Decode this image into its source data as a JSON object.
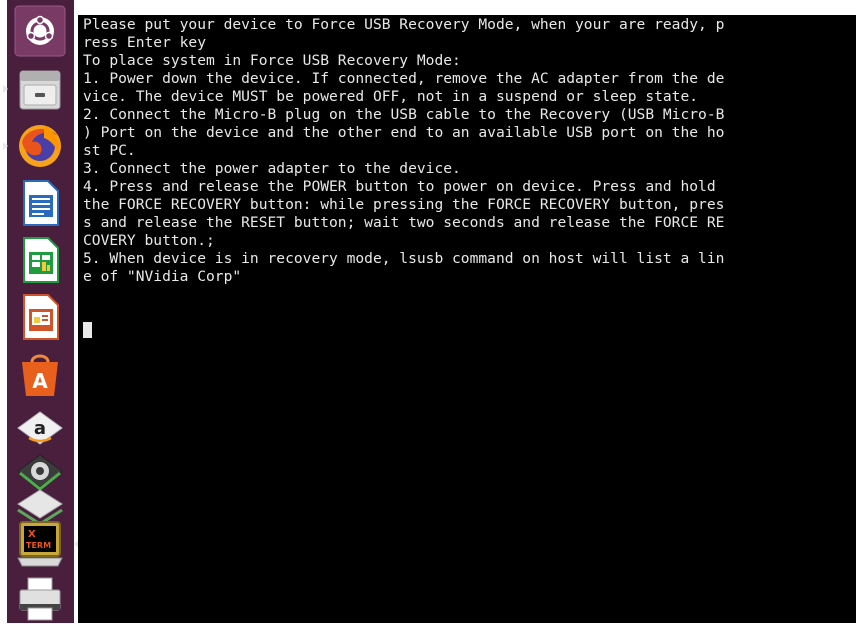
{
  "dock": {
    "icons": [
      "ubuntu-logo-icon",
      "files-icon",
      "firefox-icon",
      "writer-icon",
      "calc-icon",
      "impress-icon",
      "software-icon",
      "amazon-icon",
      "settings-icon",
      "workspace-icon",
      "xterm-icon",
      "printer-icon"
    ],
    "xterm_label_top": "X",
    "xterm_label_bottom": "TERM",
    "amazon_label": "a"
  },
  "terminal": {
    "lines": [
      "Please put your device to Force USB Recovery Mode, when your are ready, p",
      "ress Enter key",
      "To place system in Force USB Recovery Mode:",
      "1. Power down the device. If connected, remove the AC adapter from the de",
      "vice. The device MUST be powered OFF, not in a suspend or sleep state.",
      "2. Connect the Micro-B plug on the USB cable to the Recovery (USB Micro-B",
      ") Port on the device and the other end to an available USB port on the ho",
      "st PC.",
      "3. Connect the power adapter to the device.",
      "4. Press and release the POWER button to power on device. Press and hold ",
      "the FORCE RECOVERY button: while pressing the FORCE RECOVERY button, pres",
      "s and release the RESET button; wait two seconds and release the FORCE RE",
      "COVERY button.;",
      "5. When device is in recovery mode, lsusb command on host will list a lin",
      "e of \"NVidia Corp\""
    ]
  },
  "colors": {
    "dock_bg": "#4a1f3e",
    "terminal_bg": "#000000",
    "terminal_fg": "#e8e8e8",
    "accent": "#e95420"
  }
}
